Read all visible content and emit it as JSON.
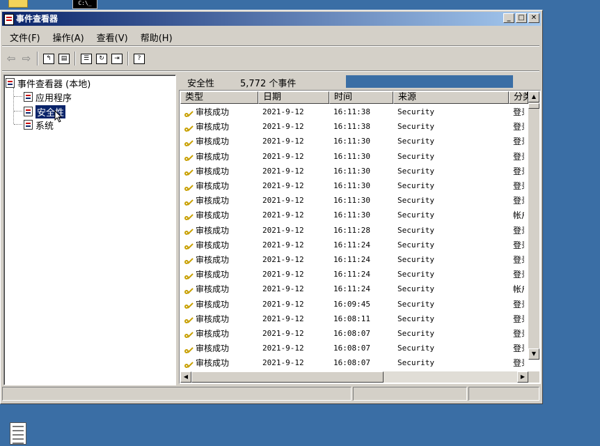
{
  "desktop": {
    "folder_icon": "folder-icon",
    "cmd_icon": "cmd-icon",
    "cmd_text": "C:\\_",
    "notepad_icon": "notepad-icon"
  },
  "window": {
    "title": "事件查看器",
    "controls": [
      "minimize",
      "maximize",
      "close"
    ]
  },
  "menu": [
    "文件(F)",
    "操作(A)",
    "查看(V)",
    "帮助(H)"
  ],
  "toolbar": [
    "back-arrow-icon",
    "forward-arrow-icon",
    "up-folder-icon",
    "show-tree-icon",
    "properties-icon",
    "refresh-icon",
    "export-icon",
    "help-icon"
  ],
  "tree": {
    "root": "事件查看器 (本地)",
    "items": [
      "应用程序",
      "安全性",
      "系统"
    ],
    "selected": "安全性"
  },
  "list": {
    "title": "安全性",
    "count": "5,772 个事件",
    "columns": [
      "类型",
      "日期",
      "时间",
      "来源",
      "分类"
    ],
    "rows": [
      {
        "type": "审核成功",
        "date": "2021-9-12",
        "time": "16:11:38",
        "source": "Security",
        "category": "登录"
      },
      {
        "type": "审核成功",
        "date": "2021-9-12",
        "time": "16:11:38",
        "source": "Security",
        "category": "登录"
      },
      {
        "type": "审核成功",
        "date": "2021-9-12",
        "time": "16:11:30",
        "source": "Security",
        "category": "登录"
      },
      {
        "type": "审核成功",
        "date": "2021-9-12",
        "time": "16:11:30",
        "source": "Security",
        "category": "登录"
      },
      {
        "type": "审核成功",
        "date": "2021-9-12",
        "time": "16:11:30",
        "source": "Security",
        "category": "登录"
      },
      {
        "type": "审核成功",
        "date": "2021-9-12",
        "time": "16:11:30",
        "source": "Security",
        "category": "登录"
      },
      {
        "type": "审核成功",
        "date": "2021-9-12",
        "time": "16:11:30",
        "source": "Security",
        "category": "登录"
      },
      {
        "type": "审核成功",
        "date": "2021-9-12",
        "time": "16:11:30",
        "source": "Security",
        "category": "帐户"
      },
      {
        "type": "审核成功",
        "date": "2021-9-12",
        "time": "16:11:28",
        "source": "Security",
        "category": "登录"
      },
      {
        "type": "审核成功",
        "date": "2021-9-12",
        "time": "16:11:24",
        "source": "Security",
        "category": "登录"
      },
      {
        "type": "审核成功",
        "date": "2021-9-12",
        "time": "16:11:24",
        "source": "Security",
        "category": "登录"
      },
      {
        "type": "审核成功",
        "date": "2021-9-12",
        "time": "16:11:24",
        "source": "Security",
        "category": "登录"
      },
      {
        "type": "审核成功",
        "date": "2021-9-12",
        "time": "16:11:24",
        "source": "Security",
        "category": "帐户"
      },
      {
        "type": "审核成功",
        "date": "2021-9-12",
        "time": "16:09:45",
        "source": "Security",
        "category": "登录"
      },
      {
        "type": "审核成功",
        "date": "2021-9-12",
        "time": "16:08:11",
        "source": "Security",
        "category": "登录"
      },
      {
        "type": "审核成功",
        "date": "2021-9-12",
        "time": "16:08:07",
        "source": "Security",
        "category": "登录"
      },
      {
        "type": "审核成功",
        "date": "2021-9-12",
        "time": "16:08:07",
        "source": "Security",
        "category": "登录"
      },
      {
        "type": "审核成功",
        "date": "2021-9-12",
        "time": "16:08:07",
        "source": "Security",
        "category": "登录"
      }
    ]
  }
}
